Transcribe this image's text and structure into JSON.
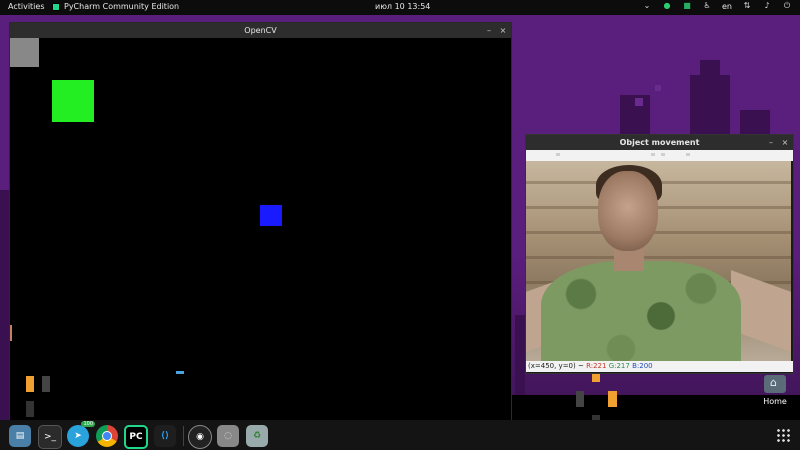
{
  "topbar": {
    "activities": "Activities",
    "app_name": "PyCharm Community Edition",
    "clock": "июл 10  13:54",
    "language": "en",
    "tray_icons": [
      "chevron-down-icon",
      "green-circle-icon",
      "green-square-icon",
      "accessibility-icon",
      "network-icon",
      "volume-icon",
      "power-icon"
    ]
  },
  "windows": {
    "opencv": {
      "title": "OpenCV",
      "minimize": "–",
      "close": "×",
      "blocks": [
        {
          "name": "gray-square",
          "color": "#888888"
        },
        {
          "name": "green-square",
          "color": "#22ee22"
        },
        {
          "name": "blue-square",
          "color": "#1a1aff"
        }
      ]
    },
    "object_movement": {
      "title": "Object movement",
      "minimize": "–",
      "close": "×",
      "status": {
        "coords": "(x=450, y=0) ~",
        "r": "R:221",
        "g": "G:217",
        "b": "B:200"
      }
    }
  },
  "desktop": {
    "home_label": "Home"
  },
  "dock": {
    "items": [
      {
        "name": "files-icon",
        "glyph": "▤"
      },
      {
        "name": "terminal-icon",
        "glyph": ">_"
      },
      {
        "name": "telegram-icon",
        "glyph": "➤",
        "badge": "100"
      },
      {
        "name": "chrome-icon",
        "glyph": "◎"
      },
      {
        "name": "pycharm-icon",
        "glyph": "PC"
      },
      {
        "name": "vscode-icon",
        "glyph": "⟨⟩"
      },
      {
        "name": "obs-icon",
        "glyph": "◉"
      },
      {
        "name": "disk-icon",
        "glyph": "◌"
      },
      {
        "name": "trash-icon",
        "glyph": "♻"
      }
    ]
  }
}
